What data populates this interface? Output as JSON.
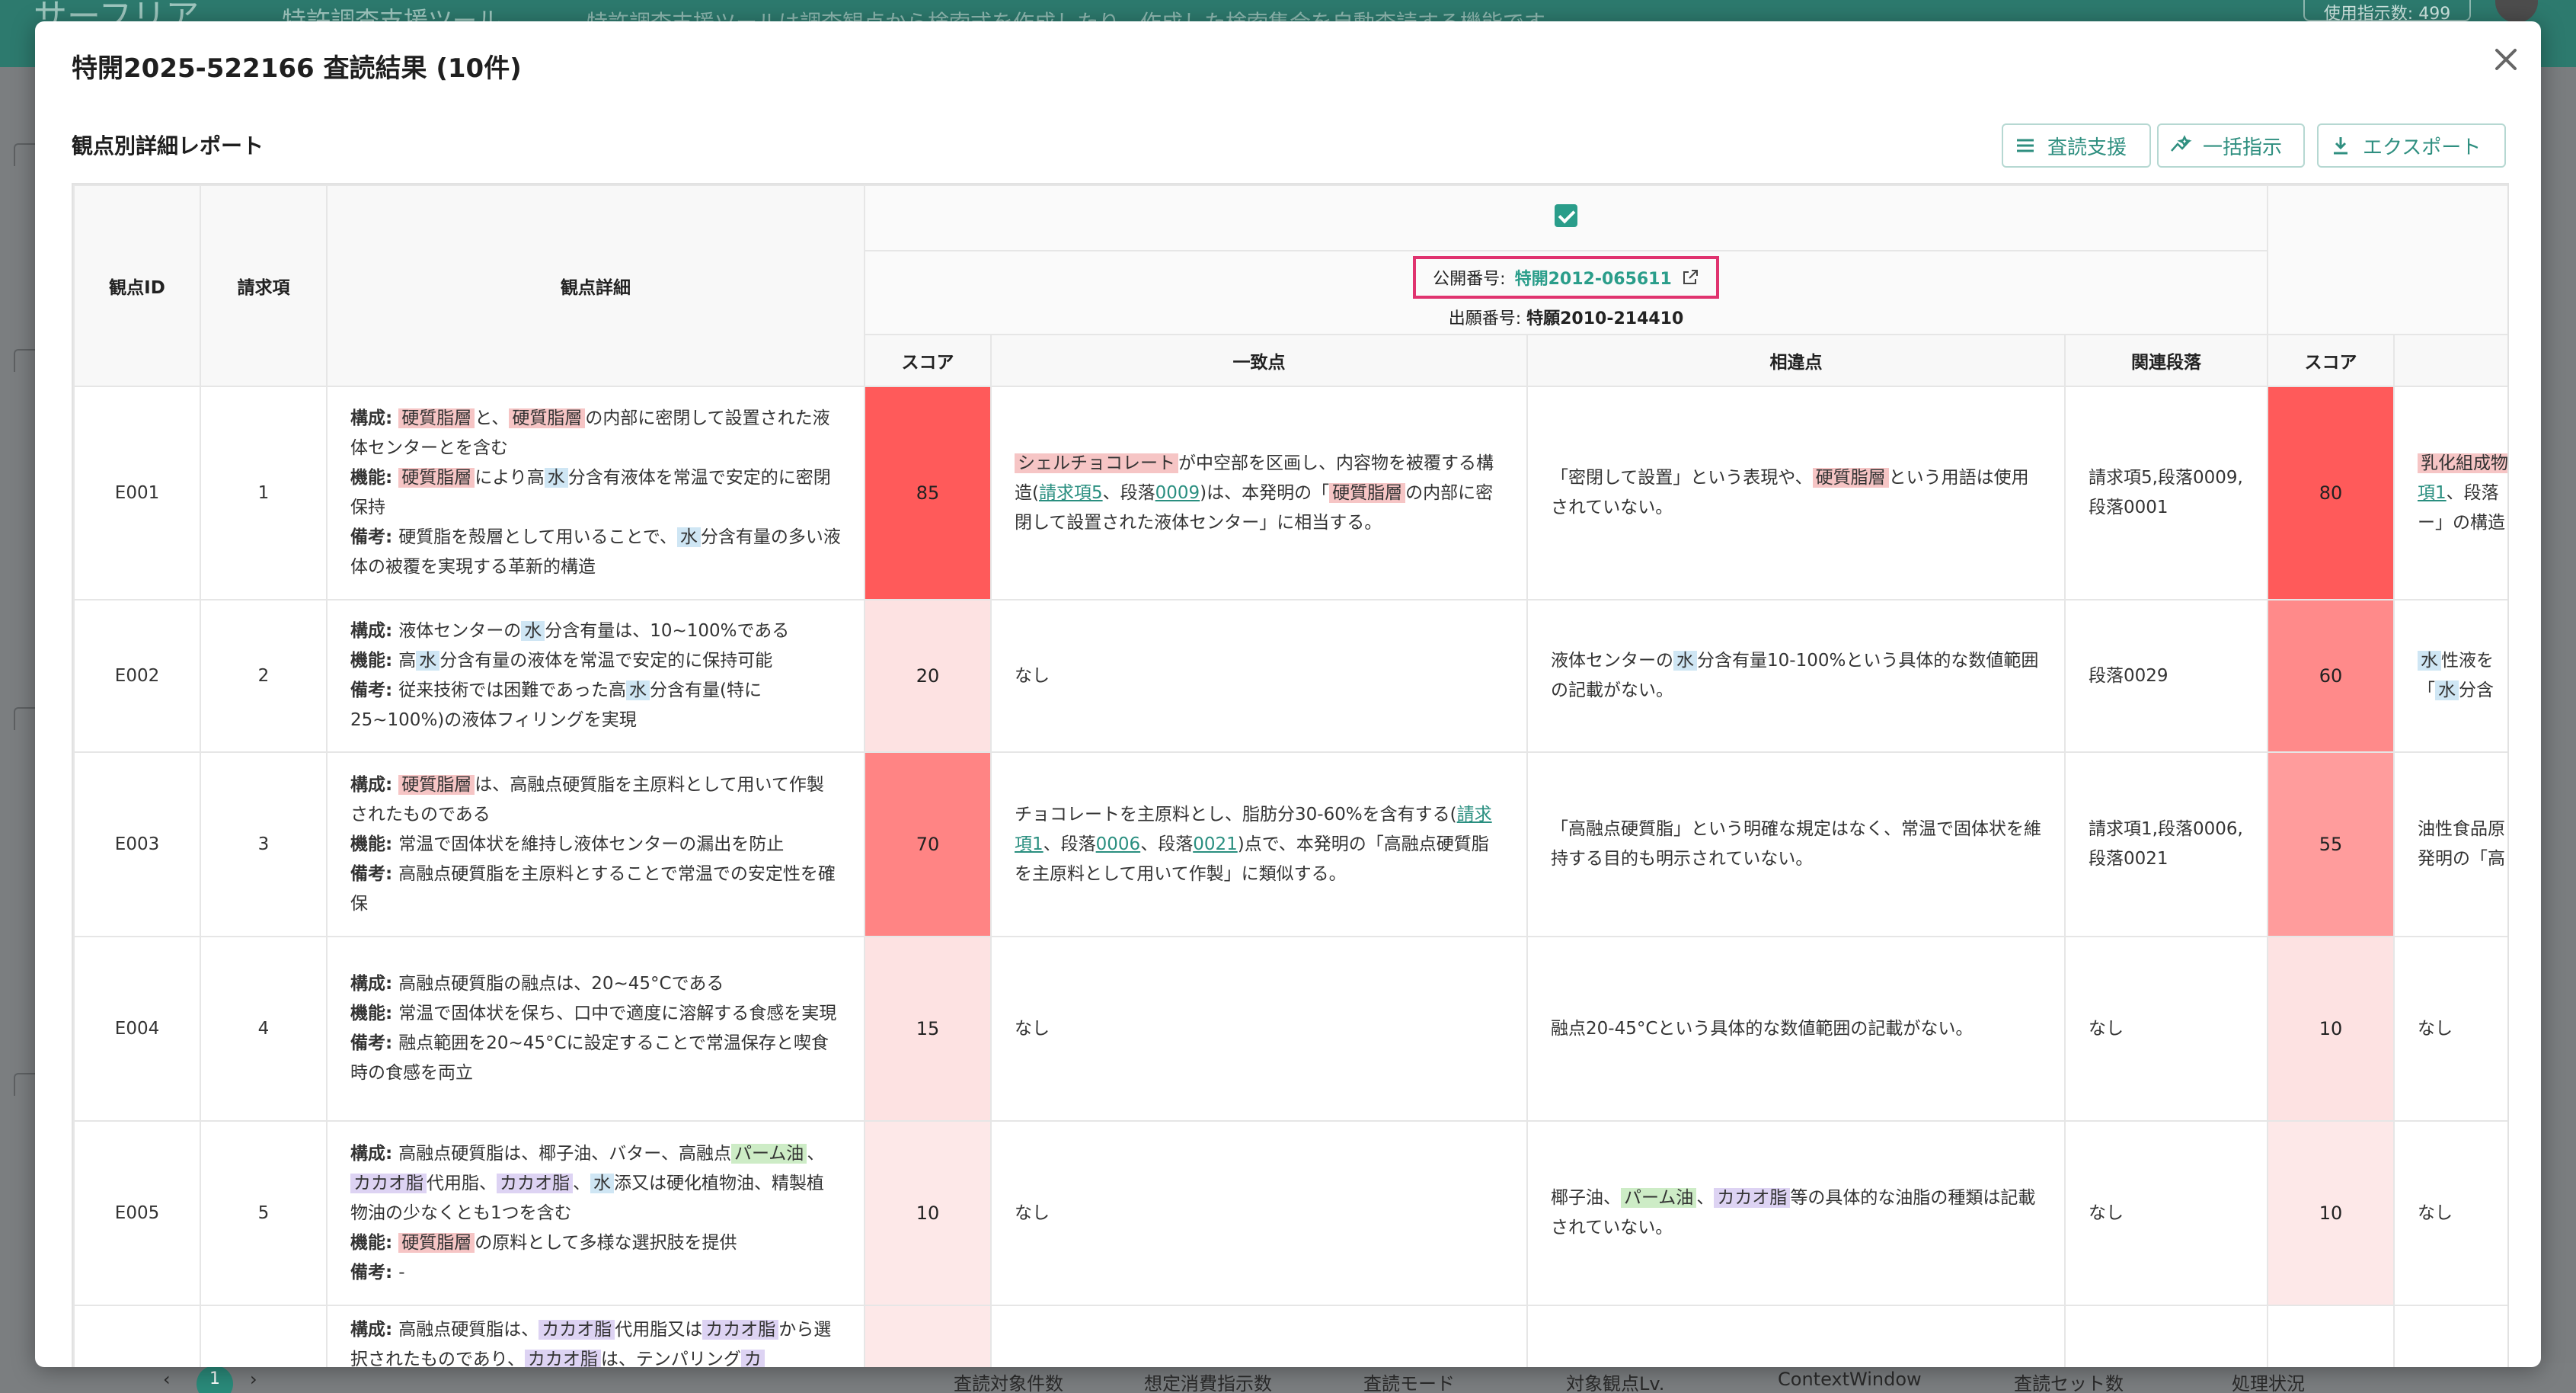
{
  "background": {
    "logo": "サーフリア",
    "tool_name": "特許調査支援ツール",
    "description": "特許調査支援ツールは調査観点から検索式を作成したり、作成した検索集合を自動査読する機能です",
    "usage": "使用指示数: 499",
    "pager_current": "1",
    "bottom_labels": [
      "査読対象件数",
      "想定消費指示数",
      "査読モード",
      "対象観点Lv.",
      "ContextWindow",
      "査読セット数",
      "処理状況"
    ]
  },
  "modal": {
    "title": "特開2025-522166 査読結果 (10件)",
    "subtitle": "観点別詳細レポート",
    "buttons": {
      "review_support": "査読支援",
      "bulk": "一括指示",
      "export": "エクスポート"
    }
  },
  "table": {
    "headers": {
      "id": "観点ID",
      "claim": "請求項",
      "detail": "観点詳細",
      "score": "スコア",
      "match": "一致点",
      "diff": "相違点",
      "para": "関連段落"
    },
    "doc1": {
      "pub_label": "公開番号: ",
      "pub_no": "特開2012-065611",
      "app_label": "出願番号: ",
      "app_no": "特願2010-214410"
    },
    "labels": {
      "struct": "構成: ",
      "func": "機能: ",
      "note": "備考: "
    },
    "rows": [
      {
        "id": "E001",
        "claim": "1",
        "d1a": "硬質脂層",
        "d1b": "と、",
        "d1c": "硬質脂層",
        "d1d": "の内部に密閉して設置された液体センターとを含む",
        "d2a": "硬質脂層",
        "d2b": "により高",
        "d2c": "水",
        "d2d": "分含有液体を常温で安定的に密閉保持",
        "d3a": "硬質脂を殻層として用いることで、",
        "d3b": "水",
        "d3c": "分含有量の多い液体の被覆を実現する革新的構造",
        "score1": "85",
        "m_a": "シェルチョコレート",
        "m_b": "が中空部を区画し、内容物を被覆する構造(",
        "m_c": "請求項5",
        "m_d": "、段落",
        "m_e": "0009",
        "m_f": ")は、本発明の「",
        "m_g": "硬質脂層",
        "m_h": "の内部に密閉して設置された液体センター」に相当する。",
        "x_a": "「密閉して設置」という表現や、",
        "x_b": "硬質脂層",
        "x_c": "という用語は使用されていない。",
        "para1": "請求項5,段落0009,段落0001",
        "score2": "80",
        "n_a": "乳化組成物",
        "n_b": "項1",
        "n_c": "、段落",
        "n_d": "ー」の構造"
      },
      {
        "id": "E002",
        "claim": "2",
        "d1a": "液体センターの",
        "d1b": "水",
        "d1c": "分含有量は、10~100%である",
        "d2a": "高",
        "d2b": "水",
        "d2c": "分含有量の液体を常温で安定的に保持可能",
        "d3a": "従来技術では困難であった高",
        "d3b": "水",
        "d3c": "分含有量(特に25~100%)の液体フィリングを実現",
        "score1": "20",
        "match": "なし",
        "x_a": "液体センターの",
        "x_b": "水",
        "x_c": "分含有量10-100%という具体的な数値範囲の記載がない。",
        "para1": "段落0029",
        "score2": "60",
        "n_a": "水",
        "n_b": "性液を",
        "n_c": "「",
        "n_d": "水",
        "n_e": "分含"
      },
      {
        "id": "E003",
        "claim": "3",
        "d1a": "硬質脂層",
        "d1b": "は、高融点硬質脂を主原料として用いて作製されたものである",
        "d2": "常温で固体状を維持し液体センターの漏出を防止",
        "d3": "高融点硬質脂を主原料とすることで常温での安定性を確保",
        "score1": "70",
        "m_a": "チョコレートを主原料とし、脂肪分30-60%を含有する(",
        "m_b": "請求項1",
        "m_c": "、段落",
        "m_d": "0006",
        "m_e": "、段落",
        "m_f": "0021",
        "m_g": ")点で、本発明の「高融点硬質脂を主原料として用いて作製」に類似する。",
        "diff": "「高融点硬質脂」という明確な規定はなく、常温で固体状を維持する目的も明示されていない。",
        "para1": "請求項1,段落0006,段落0021",
        "score2": "55",
        "n_a": "油性食品原",
        "n_b": "発明の「高"
      },
      {
        "id": "E004",
        "claim": "4",
        "d1": "高融点硬質脂の融点は、20~45°Cである",
        "d2": "常温で固体状を保ち、口中で適度に溶解する食感を実現",
        "d3": "融点範囲を20~45°Cに設定することで常温保存と喫食時の食感を両立",
        "score1": "15",
        "match": "なし",
        "diff": "融点20-45°Cという具体的な数値範囲の記載がない。",
        "para1": "なし",
        "score2": "10",
        "n": "なし"
      },
      {
        "id": "E005",
        "claim": "5",
        "d1a": "高融点硬質脂は、椰子油、バター、高融点",
        "d1b": "パーム油",
        "d1c": "、",
        "d1d": "カカオ脂",
        "d1e": "代用脂、",
        "d1f": "カカオ脂",
        "d1g": "、",
        "d1h": "水",
        "d1i": "添又は硬化植物油、精製植物油の少なくとも1つを含む",
        "d2a": "硬質脂層",
        "d2b": "の原料として多様な選択肢を提供",
        "d3": "-",
        "score1": "10",
        "match": "なし",
        "x_a": "椰子油、",
        "x_b": "パーム油",
        "x_c": "、",
        "x_d": "カカオ脂",
        "x_e": "等の具体的な油脂の種類は記載されていない。",
        "para1": "なし",
        "score2": "10",
        "n": "なし"
      },
      {
        "d1a": "高融点硬質脂は、",
        "d1b": "カカオ脂",
        "d1c": "代用脂又は",
        "d1d": "カカオ脂",
        "d1e": "から選択されたものであり、",
        "d1f": "カカオ脂",
        "d1g": "は、テンパリング",
        "d1h": "カ"
      }
    ]
  },
  "colors": {
    "score_high": "#ff5a5a",
    "score_70": "#ff8484",
    "score_55": "#ff9c9c",
    "score_low": "#fde2e2",
    "accent": "#2a9d8a",
    "highlight_box": "#e0336f"
  }
}
